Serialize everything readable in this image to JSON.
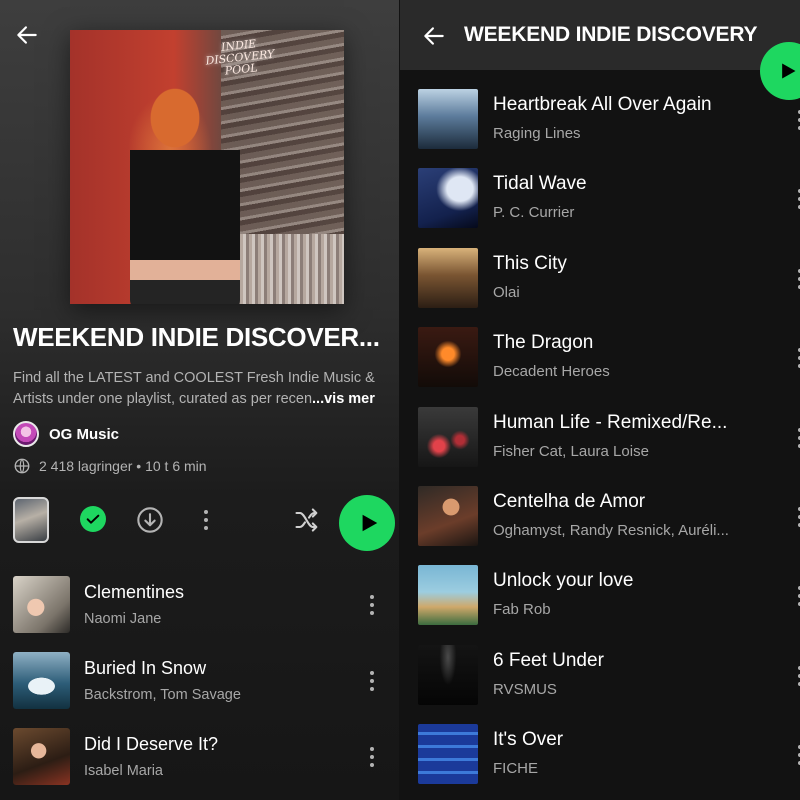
{
  "left": {
    "cover_text": "INDIE DISCOVERY POOL",
    "title": "WEEKEND INDIE DISCOVER...",
    "description": "Find all the LATEST and COOLEST Fresh Indie Music & Artists under one playlist, curated as per recen",
    "description_more": "...vis mer",
    "owner": "OG Music",
    "meta": "2 418 lagringer • 10 t 6 min",
    "tracks": [
      {
        "title": "Clementines",
        "artist": "Naomi Jane"
      },
      {
        "title": "Buried In Snow",
        "artist": "Backstrom, Tom Savage"
      },
      {
        "title": "Did I Deserve It?",
        "artist": "Isabel Maria"
      }
    ]
  },
  "right": {
    "title": "WEEKEND INDIE DISCOVERY",
    "tracks": [
      {
        "title": "Heartbreak All Over Again",
        "artist": "Raging Lines"
      },
      {
        "title": "Tidal Wave",
        "artist": "P. C. Currier"
      },
      {
        "title": "This City",
        "artist": "Olai"
      },
      {
        "title": "The Dragon",
        "artist": "Decadent Heroes"
      },
      {
        "title": "Human Life - Remixed/Re...",
        "artist": "Fisher Cat, Laura Loise"
      },
      {
        "title": "Centelha de Amor",
        "artist": "Oghamyst, Randy Resnick, Auréli..."
      },
      {
        "title": "Unlock your love",
        "artist": "Fab Rob"
      },
      {
        "title": "6 Feet Under",
        "artist": "RVSMUS"
      },
      {
        "title": "It's Over",
        "artist": "FICHE"
      }
    ]
  },
  "colors": {
    "accent_green": "#1ed760",
    "background": "#121212",
    "secondary_text": "#b3b3b3"
  },
  "icons": {
    "back": "arrow-left-icon",
    "saved": "check-icon",
    "download": "download-icon",
    "more": "more-vertical-icon",
    "shuffle": "shuffle-icon",
    "play": "play-icon",
    "globe": "globe-icon"
  }
}
